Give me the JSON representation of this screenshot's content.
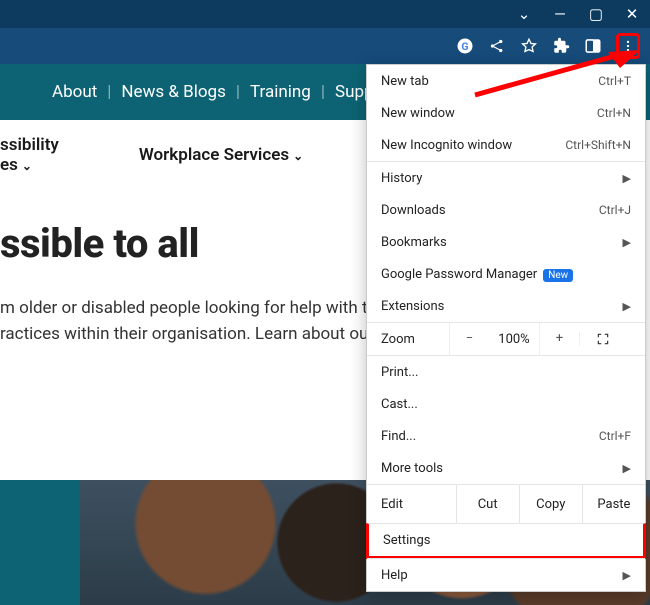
{
  "window_controls": {
    "minimize": "—",
    "maximize": "▢",
    "close": "✕",
    "dropdown": "⌄"
  },
  "toolbar_icons": [
    "google",
    "share",
    "star",
    "puzzle",
    "panel",
    "more"
  ],
  "site_nav": {
    "items": [
      "About",
      "News & Blogs",
      "Training",
      "Supp"
    ]
  },
  "subnav": {
    "item1_line1": "ssibility",
    "item1_line2": "es",
    "item2": "Workplace Services"
  },
  "hero": {
    "title": "ssible to all",
    "body": "m older or disabled people looking for help with t\nractices within their organisation. Learn about ou"
  },
  "menu": {
    "g1": [
      {
        "label": "New tab",
        "short": "Ctrl+T"
      },
      {
        "label": "New window",
        "short": "Ctrl+N"
      },
      {
        "label": "New Incognito window",
        "short": "Ctrl+Shift+N"
      }
    ],
    "g2": [
      {
        "label": "History",
        "sub": true
      },
      {
        "label": "Downloads",
        "short": "Ctrl+J"
      },
      {
        "label": "Bookmarks",
        "sub": true
      },
      {
        "label": "Google Password Manager",
        "badge": "New"
      },
      {
        "label": "Extensions",
        "sub": true
      }
    ],
    "zoom": {
      "label": "Zoom",
      "pct": "100%",
      "minus": "−",
      "plus": "+"
    },
    "g3": [
      {
        "label": "Print..."
      },
      {
        "label": "Cast..."
      },
      {
        "label": "Find...",
        "short": "Ctrl+F"
      },
      {
        "label": "More tools",
        "sub": true
      }
    ],
    "edit": {
      "label": "Edit",
      "cut": "Cut",
      "copy": "Copy",
      "paste": "Paste"
    },
    "settings": "Settings",
    "help": {
      "label": "Help",
      "sub": true
    }
  }
}
